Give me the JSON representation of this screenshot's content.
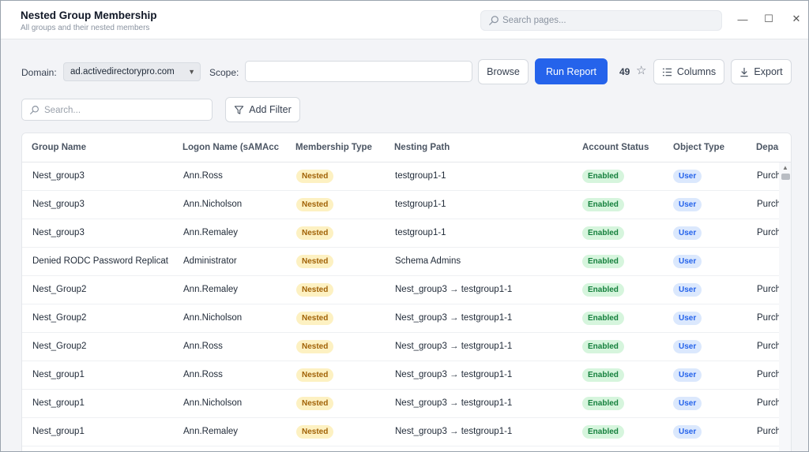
{
  "header": {
    "title": "Nested Group Membership",
    "subtitle": "All groups and their nested members",
    "search_placeholder": "Search pages..."
  },
  "window_controls": {
    "minimize": "—",
    "maximize": "☐",
    "close": "✕"
  },
  "toolbar": {
    "domain_label": "Domain:",
    "domain_value": "ad.activedirectorypro.com",
    "scope_label": "Scope:",
    "scope_value": "",
    "browse_label": "Browse",
    "run_label": "Run Report",
    "result_count": "49",
    "columns_label": "Columns",
    "export_label": "Export"
  },
  "filter": {
    "search_placeholder": "Search...",
    "add_filter_label": "Add Filter"
  },
  "table": {
    "columns": [
      "Group Name",
      "Logon Name (sAMAcco",
      "Membership Type",
      "Nesting Path",
      "Account Status",
      "Object Type",
      "Depar"
    ],
    "rows": [
      {
        "group": "Nest_group3",
        "logon": "Ann.Ross",
        "type": "Nested",
        "path": "testgroup1-1",
        "status": "Enabled",
        "object": "User",
        "dept": "Purch"
      },
      {
        "group": "Nest_group3",
        "logon": "Ann.Nicholson",
        "type": "Nested",
        "path": "testgroup1-1",
        "status": "Enabled",
        "object": "User",
        "dept": "Purch"
      },
      {
        "group": "Nest_group3",
        "logon": "Ann.Remaley",
        "type": "Nested",
        "path": "testgroup1-1",
        "status": "Enabled",
        "object": "User",
        "dept": "Purch"
      },
      {
        "group": "Denied RODC Password Replicat",
        "logon": "Administrator",
        "type": "Nested",
        "path": "Schema Admins",
        "status": "Enabled",
        "object": "User",
        "dept": ""
      },
      {
        "group": "Nest_Group2",
        "logon": "Ann.Remaley",
        "type": "Nested",
        "path": "Nest_group3 → testgroup1-1",
        "status": "Enabled",
        "object": "User",
        "dept": "Purch"
      },
      {
        "group": "Nest_Group2",
        "logon": "Ann.Nicholson",
        "type": "Nested",
        "path": "Nest_group3 → testgroup1-1",
        "status": "Enabled",
        "object": "User",
        "dept": "Purch"
      },
      {
        "group": "Nest_Group2",
        "logon": "Ann.Ross",
        "type": "Nested",
        "path": "Nest_group3 → testgroup1-1",
        "status": "Enabled",
        "object": "User",
        "dept": "Purch"
      },
      {
        "group": "Nest_group1",
        "logon": "Ann.Ross",
        "type": "Nested",
        "path": "Nest_group3 → testgroup1-1",
        "status": "Enabled",
        "object": "User",
        "dept": "Purch"
      },
      {
        "group": "Nest_group1",
        "logon": "Ann.Nicholson",
        "type": "Nested",
        "path": "Nest_group3 → testgroup1-1",
        "status": "Enabled",
        "object": "User",
        "dept": "Purch"
      },
      {
        "group": "Nest_group1",
        "logon": "Ann.Remaley",
        "type": "Nested",
        "path": "Nest_group3 → testgroup1-1",
        "status": "Enabled",
        "object": "User",
        "dept": "Purch"
      }
    ]
  },
  "icons": {
    "search": "search-icon",
    "star": "star-icon",
    "columns": "columns-icon",
    "export": "download-icon",
    "filter": "filter-icon"
  },
  "colors": {
    "accent": "#2563eb",
    "nested_badge_bg": "#fdf1c2",
    "enabled_badge_bg": "#d6f5dd",
    "user_badge_bg": "#dbe8fd"
  }
}
